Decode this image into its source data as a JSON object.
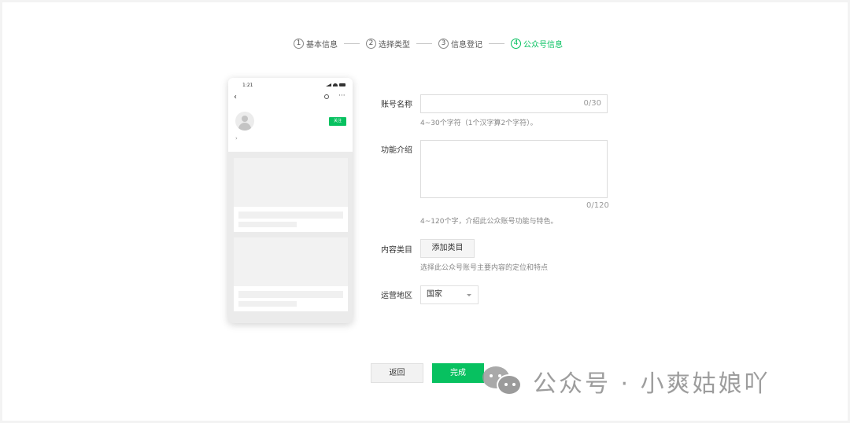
{
  "steps": [
    {
      "num": "1",
      "label": "基本信息"
    },
    {
      "num": "2",
      "label": "选择类型"
    },
    {
      "num": "3",
      "label": "信息登记"
    },
    {
      "num": "4",
      "label": "公众号信息"
    }
  ],
  "preview": {
    "time": "1:21",
    "back": "‹",
    "more": "···",
    "follow_label": "关注",
    "chevron": "›"
  },
  "form": {
    "account_name": {
      "label": "账号名称",
      "value": "",
      "count": "0/30",
      "hint": "4~30个字符（1个汉字算2个字符）。"
    },
    "intro": {
      "label": "功能介绍",
      "value": "",
      "count": "0/120",
      "hint": "4~120个字，介绍此公众账号功能与特色。"
    },
    "category": {
      "label": "内容类目",
      "button": "添加类目",
      "hint": "选择此公众号账号主要内容的定位和特点"
    },
    "region": {
      "label": "运营地区",
      "selected": "国家"
    }
  },
  "actions": {
    "back": "返回",
    "done": "完成"
  },
  "watermark": {
    "text": "公众号 · 小爽姑娘吖"
  },
  "colors": {
    "accent": "#07c160",
    "border": "#dcdcdc",
    "hint": "#888888"
  }
}
